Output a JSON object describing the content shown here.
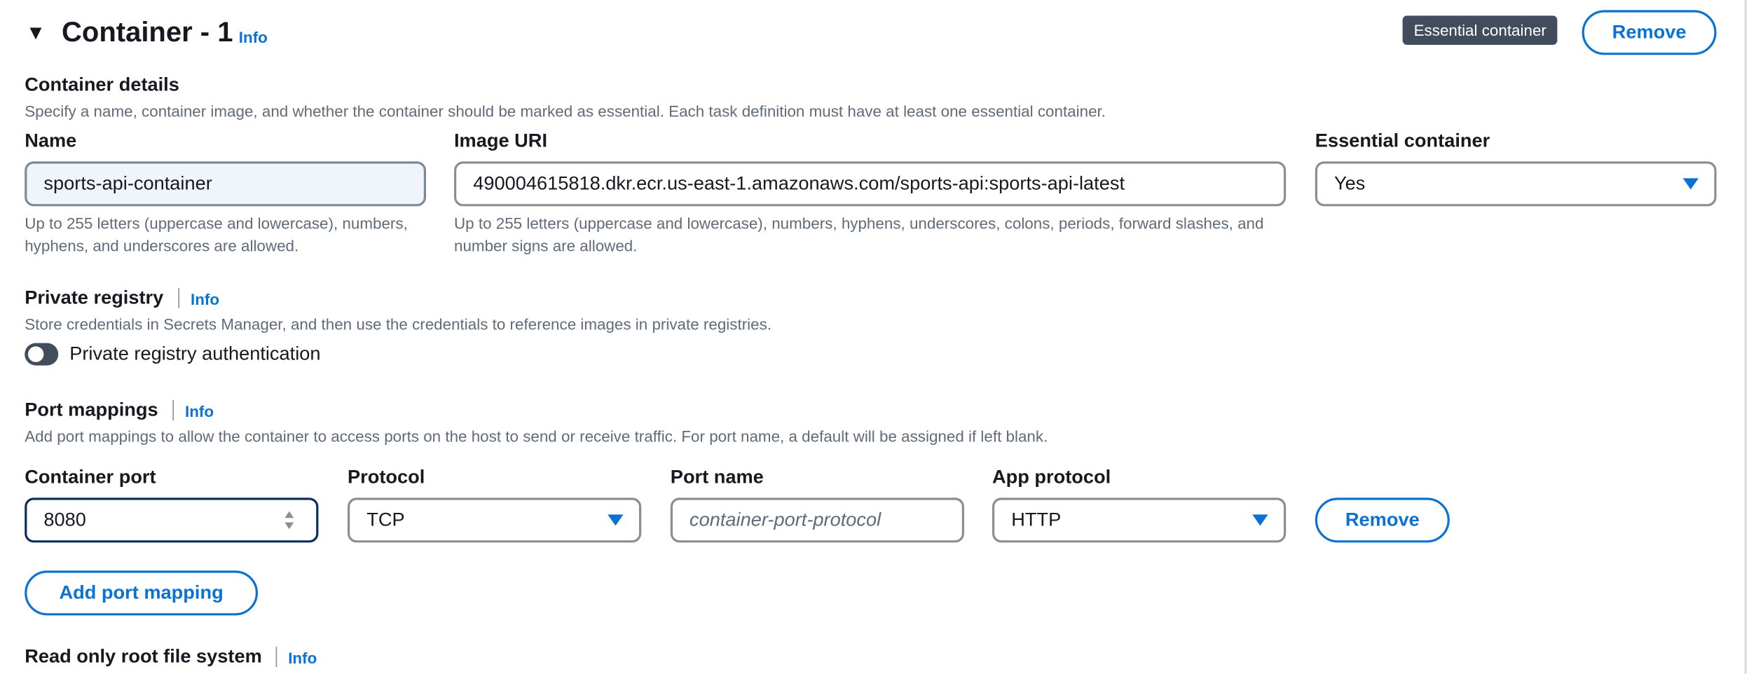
{
  "container": {
    "expand_icon": "caret-down-icon",
    "title": "Container - 1",
    "info": "Info",
    "badge": "Essential container",
    "remove_label": "Remove"
  },
  "details": {
    "heading": "Container details",
    "description": "Specify a name, container image, and whether the container should be marked as essential. Each task definition must have at least one essential container.",
    "name": {
      "label": "Name",
      "value": "sports-api-container",
      "hint": "Up to 255 letters (uppercase and lowercase), numbers, hyphens, and underscores are allowed."
    },
    "image_uri": {
      "label": "Image URI",
      "value": "490004615818.dkr.ecr.us-east-1.amazonaws.com/sports-api:sports-api-latest",
      "hint": "Up to 255 letters (uppercase and lowercase), numbers, hyphens, underscores, colons, periods, forward slashes, and number signs are allowed."
    },
    "essential": {
      "label": "Essential container",
      "value": "Yes"
    }
  },
  "private_registry": {
    "heading": "Private registry",
    "info": "Info",
    "description": "Store credentials in Secrets Manager, and then use the credentials to reference images in private registries.",
    "toggle_label": "Private registry authentication",
    "toggle_on": false
  },
  "port_mappings": {
    "heading": "Port mappings",
    "info": "Info",
    "description": "Add port mappings to allow the container to access ports on the host to send or receive traffic. For port name, a default will be assigned if left blank.",
    "container_port": {
      "label": "Container port",
      "value": "8080"
    },
    "protocol": {
      "label": "Protocol",
      "value": "TCP"
    },
    "port_name": {
      "label": "Port name",
      "placeholder": "container-port-protocol"
    },
    "app_protocol": {
      "label": "App protocol",
      "value": "HTTP"
    },
    "remove_label": "Remove",
    "add_label": "Add port mapping"
  },
  "read_only_root": {
    "heading": "Read only root file system",
    "info": "Info"
  },
  "colors": {
    "accent": "#0972d3",
    "text": "#16191f",
    "muted": "#5f6b7a",
    "border": "#8c8c94",
    "badge_bg": "#414d5c",
    "input_filled_bg": "#f0f5fb"
  }
}
